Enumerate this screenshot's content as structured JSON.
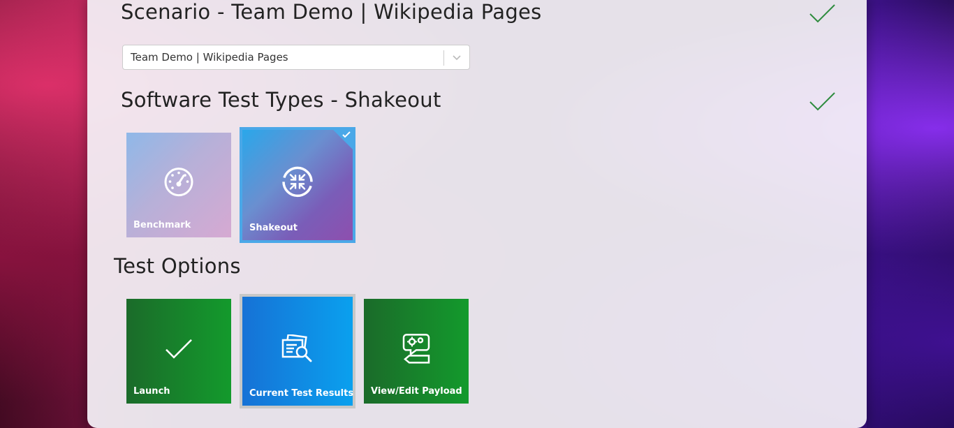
{
  "scenario": {
    "title": "Scenario - Team Demo | Wikipedia Pages",
    "select_value": "Team Demo | Wikipedia Pages"
  },
  "test_types": {
    "title": "Software Test Types - Shakeout",
    "tiles": [
      {
        "label": "Benchmark",
        "icon": "gauge-icon",
        "selected": false
      },
      {
        "label": "Shakeout",
        "icon": "shakeout-arrows-icon",
        "selected": true
      }
    ]
  },
  "test_options": {
    "title": "Test Options",
    "tiles": [
      {
        "label": "Launch",
        "icon": "checkmark-icon"
      },
      {
        "label": "Current Test Results",
        "icon": "documents-search-icon"
      },
      {
        "label": "View/Edit Payload",
        "icon": "gears-chat-icon"
      }
    ]
  },
  "colors": {
    "check_green": "#2e8b3e",
    "selected_border": "#4aa8e8",
    "option_green": "#139a2c",
    "results_blue": "#0aa0ee"
  }
}
